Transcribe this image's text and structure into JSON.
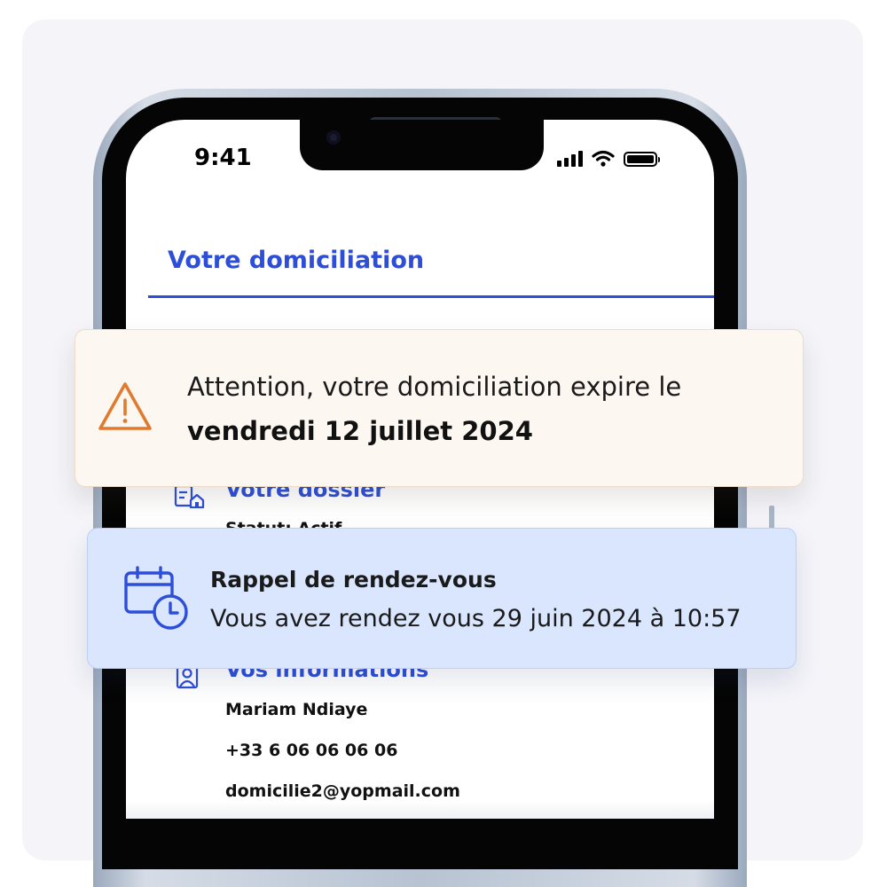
{
  "status_bar": {
    "time": "9:41",
    "icons": [
      "signal-icon",
      "wifi-icon",
      "battery-icon"
    ]
  },
  "header": {
    "title": "Votre domiciliation"
  },
  "dossier_section": {
    "icon": "document-home-icon",
    "heading": "Votre dossier",
    "status_text": "Statut: Actif"
  },
  "informations_section": {
    "icon": "user-badge-icon",
    "heading": "Vos informations",
    "name": "Mariam Ndiaye",
    "phone": "+33 6 06 06 06 06",
    "email": "domicilie2@yopmail.com"
  },
  "expiry_alert": {
    "icon": "warning-triangle-icon",
    "line1": "Attention, votre domiciliation expire le",
    "line2": "vendredi 12 juillet 2024",
    "accent_color": "#e07a2f"
  },
  "appointment_reminder": {
    "icon": "calendar-clock-icon",
    "title": "Rappel de rendez-vous",
    "text": "Vous avez rendez vous 29 juin 2024 à 10:57",
    "accent_color": "#2c4ed8"
  },
  "colors": {
    "primary_blue": "#2c4ed8",
    "alert_background": "#fdf7f1",
    "reminder_background": "#d9e6fd",
    "panel_background": "#f4f4f9"
  }
}
